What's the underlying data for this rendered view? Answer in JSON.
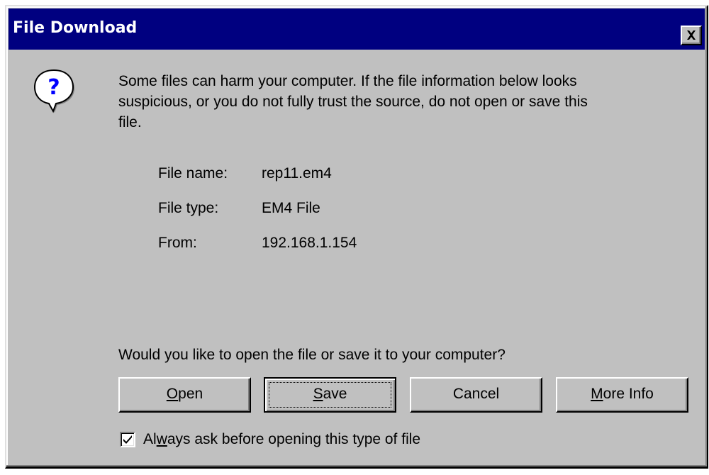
{
  "window": {
    "title": "File Download",
    "close_label": "X"
  },
  "icon": "question-mark-balloon-icon",
  "message": {
    "line1": "Some files can harm your computer. If the file information below looks",
    "line2": "suspicious, or you do not fully trust the source, do not open or save this",
    "line3": "file."
  },
  "file_info": {
    "name_label": "File name:",
    "name_value": "rep11.em4",
    "type_label": "File type:",
    "type_value": "EM4 File",
    "from_label": "From:",
    "from_value": "192.168.1.154"
  },
  "prompt": "Would you like to open the file or save it to your computer?",
  "buttons": {
    "open": {
      "mnemonic": "O",
      "rest": "pen"
    },
    "save": {
      "mnemonic": "S",
      "rest": "ave"
    },
    "cancel": {
      "label": "Cancel"
    },
    "more_info": {
      "mnemonic": "M",
      "rest": "ore Info"
    }
  },
  "checkbox": {
    "checked": true,
    "prefix": "Al",
    "mnemonic": "w",
    "suffix": "ays ask before opening this type of file"
  },
  "colors": {
    "titlebar": "#000080",
    "face": "#c0c0c0",
    "icon_blue": "#0000ff"
  }
}
